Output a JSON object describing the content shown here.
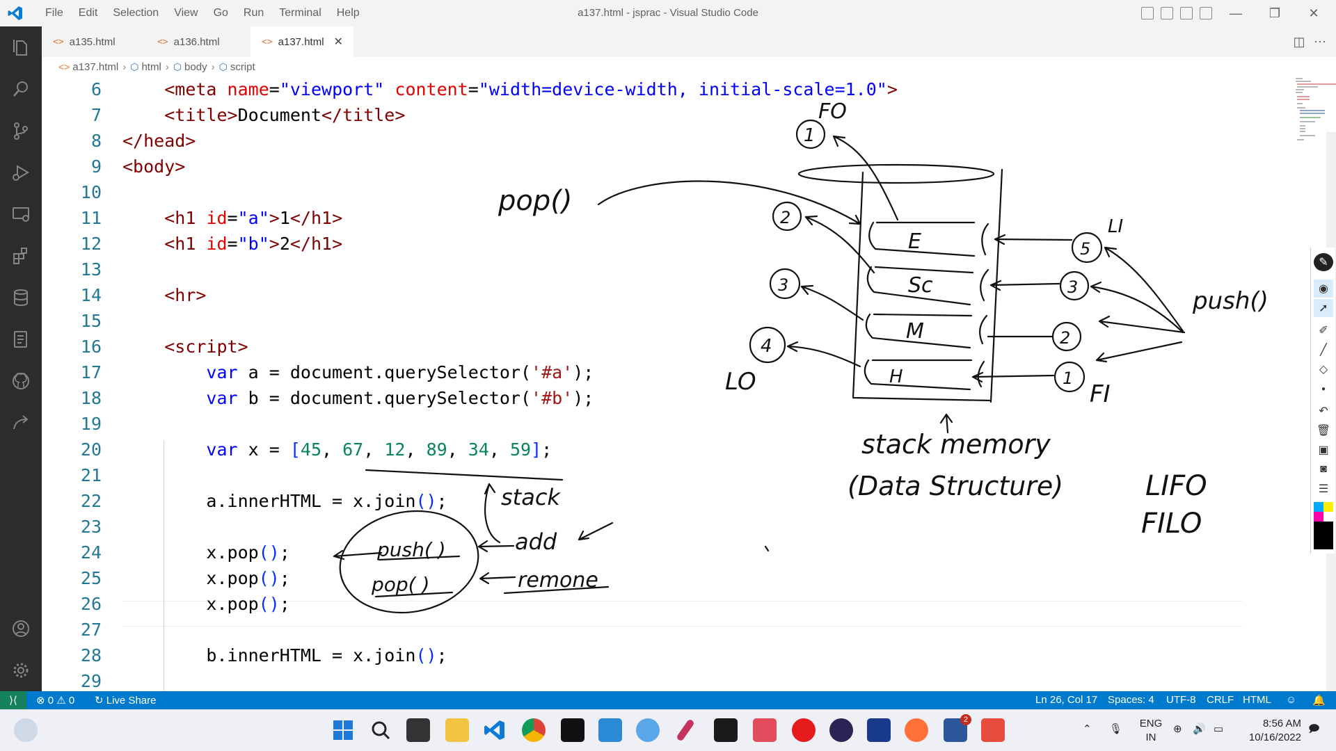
{
  "titlebar": {
    "title": "a137.html - jsprac - Visual Studio Code",
    "menu": [
      "File",
      "Edit",
      "Selection",
      "View",
      "Go",
      "Run",
      "Terminal",
      "Help"
    ]
  },
  "tabs": [
    {
      "label": "a135.html",
      "active": false
    },
    {
      "label": "a136.html",
      "active": false
    },
    {
      "label": "a137.html",
      "active": true
    }
  ],
  "breadcrumb": [
    "a137.html",
    "html",
    "body",
    "script"
  ],
  "editor": {
    "line_numbers": [
      "6",
      "7",
      "8",
      "9",
      "10",
      "11",
      "12",
      "13",
      "14",
      "15",
      "16",
      "17",
      "18",
      "19",
      "20",
      "21",
      "22",
      "23",
      "24",
      "25",
      "26",
      "27",
      "28",
      "29"
    ]
  },
  "annotations": {
    "pop_label": "pop()",
    "push_label": "push()",
    "stack_items": [
      "E",
      "Sc",
      "M",
      "H"
    ],
    "push_numbers": [
      "5",
      "3",
      "2",
      "1"
    ],
    "pop_numbers": [
      "1",
      "2",
      "3",
      "4"
    ],
    "fo": "FO",
    "li": "LI",
    "lo": "LO",
    "fi": "FI",
    "stack_memory": "stack memory",
    "data_structure": "(Data Structure)",
    "lifo": "LIFO",
    "filo": "FILO",
    "stack_note": "stack",
    "add_note": "add",
    "remove_note": "remone",
    "circle_push": "push( )",
    "circle_pop": "pop( )"
  },
  "statusbar": {
    "errors": "0",
    "warnings": "0",
    "live_share": "Live Share",
    "position": "Ln 26, Col 17",
    "spaces": "Spaces: 4",
    "encoding": "UTF-8",
    "eol": "CRLF",
    "language": "HTML"
  },
  "taskbar": {
    "language": "ENG",
    "region": "IN",
    "time": "8:56 AM",
    "date": "10/16/2022",
    "word_badge": "2"
  },
  "colors": {
    "accent": "#007acc",
    "activity_bar": "#2c2c2c",
    "remote": "#16825d"
  }
}
